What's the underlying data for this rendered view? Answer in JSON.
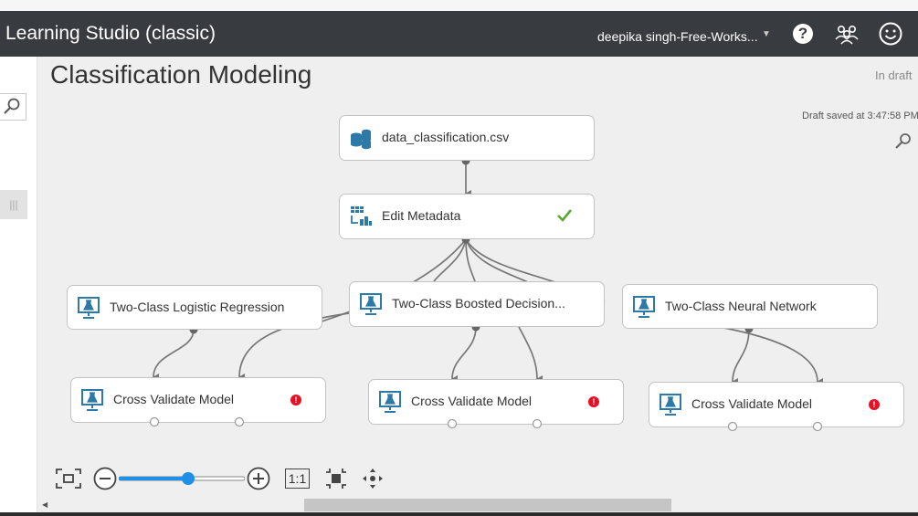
{
  "app": {
    "title": "Learning Studio (classic)",
    "workspace": "deepika singh-Free-Works...",
    "header_icons": [
      "help-icon",
      "people-icon",
      "smile-icon"
    ]
  },
  "experiment": {
    "title": "Classification Modeling",
    "status": "In draft",
    "saved": "Draft saved at 3:47:58 PM"
  },
  "modules": {
    "dataset": {
      "label": "data_classification.csv",
      "icon": "dataset-icon"
    },
    "edit_metadata": {
      "label": "Edit Metadata",
      "icon": "table-icon",
      "status": "check-icon"
    },
    "logistic": {
      "label": "Two-Class Logistic Regression",
      "icon": "flask-icon"
    },
    "boosted": {
      "label": "Two-Class Boosted Decision...",
      "icon": "flask-icon"
    },
    "neural": {
      "label": "Two-Class Neural Network",
      "icon": "flask-icon"
    },
    "cv1": {
      "label": "Cross Validate Model",
      "icon": "flask-icon",
      "status": "error-icon"
    },
    "cv2": {
      "label": "Cross Validate Model",
      "icon": "flask-icon",
      "status": "error-icon"
    },
    "cv3": {
      "label": "Cross Validate Model",
      "icon": "flask-icon",
      "status": "error-icon"
    }
  },
  "toolbar": {
    "error_symbol": "!",
    "actual_size_label": "1:1",
    "zoom_level": 0.55,
    "items": [
      "fit-to-screen-icon",
      "zoom-out-icon",
      "zoom-slider",
      "zoom-in-icon",
      "actual-size-button",
      "center-icon",
      "pan-icon"
    ]
  },
  "colors": {
    "header_bg": "#383b40",
    "accent": "#1e90e8",
    "icon_blue": "#2d79a8",
    "error": "#e81123",
    "success": "#5aa832"
  }
}
